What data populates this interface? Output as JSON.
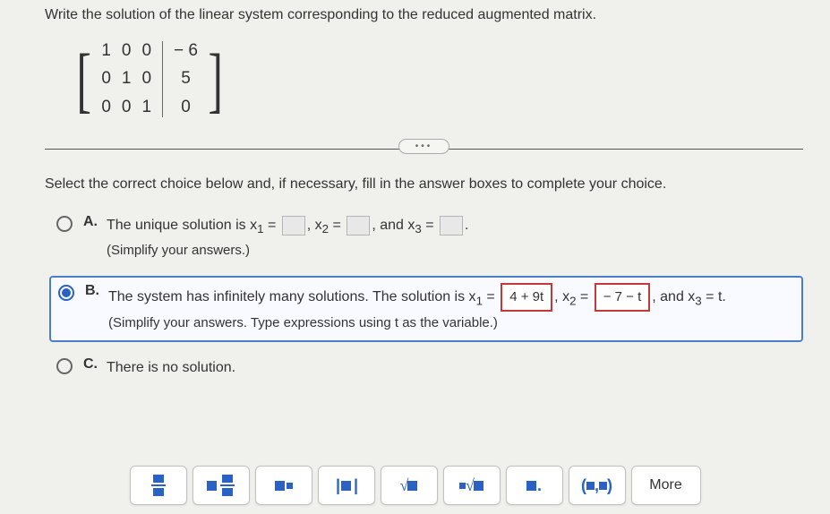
{
  "question": "Write the solution of the linear system corresponding to the reduced augmented matrix.",
  "matrix": {
    "rows_left": [
      [
        "1",
        "0",
        "0"
      ],
      [
        "0",
        "1",
        "0"
      ],
      [
        "0",
        "0",
        "1"
      ]
    ],
    "rows_right": [
      "− 6",
      "5",
      "0"
    ]
  },
  "instruction": "Select the correct choice below and, if necessary, fill in the answer boxes to complete your choice.",
  "choices": {
    "A": {
      "letter": "A.",
      "pre": "The unique solution is x",
      "mid1": ", x",
      "mid2": ", and x",
      "simplify": "(Simplify your answers.)"
    },
    "B": {
      "letter": "B.",
      "pre": "The system has infinitely many solutions. The solution is x",
      "x1_val": "4 + 9t",
      "mid1": ", x",
      "x2_val": "− 7 − t",
      "mid2": ", and x",
      "x3_rhs": " = t.",
      "simplify": "(Simplify your answers. Type expressions using t as the variable.)"
    },
    "C": {
      "letter": "C.",
      "text": "There is no solution."
    }
  },
  "toolbar": {
    "more": "More"
  }
}
